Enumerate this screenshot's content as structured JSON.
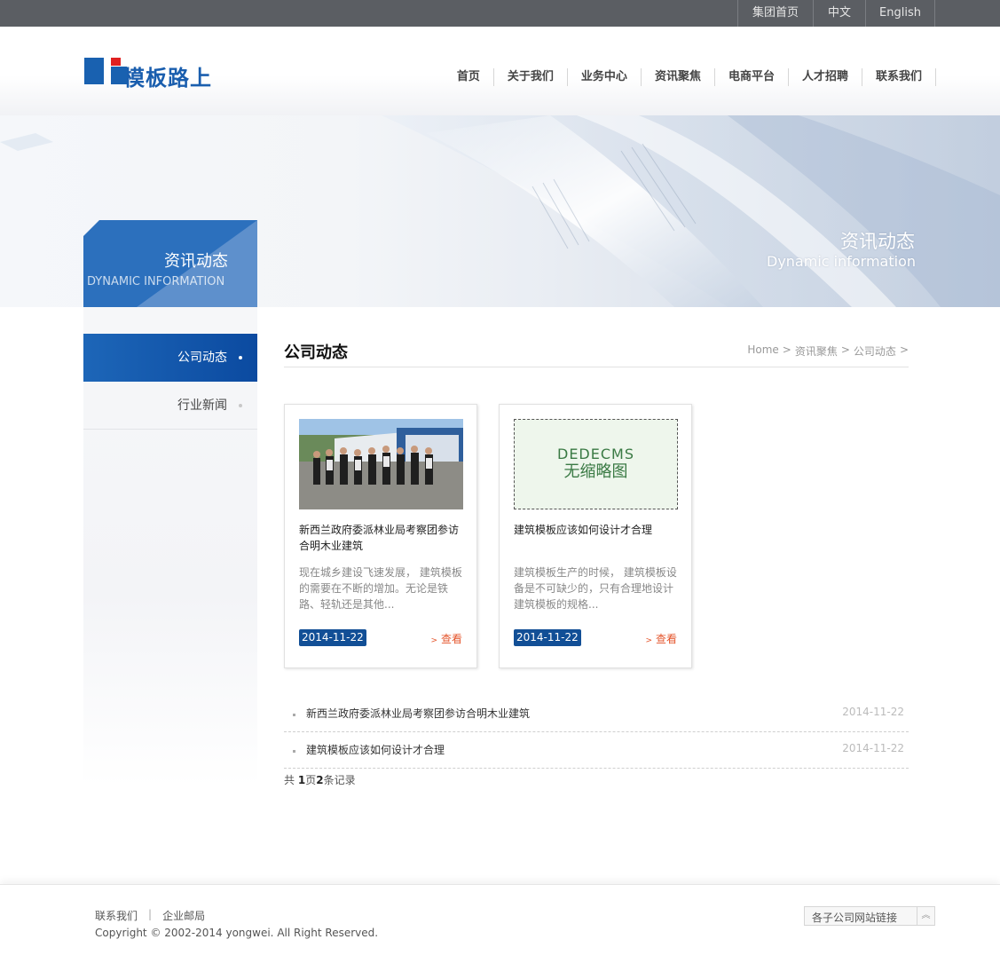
{
  "topbar": {
    "links": [
      "集团首页",
      "中文",
      "English"
    ]
  },
  "logo": {
    "text": "模板路上"
  },
  "nav": [
    "首页",
    "关于我们",
    "业务中心",
    "资讯聚焦",
    "电商平台",
    "人才招聘",
    "联系我们"
  ],
  "banner": {
    "title_cn": "资讯动态",
    "title_en": "Dynamic information"
  },
  "sidebar": {
    "heading_cn": "资讯动态",
    "heading_en": "DYNAMIC INFORMATION",
    "items": [
      {
        "label": "公司动态",
        "active": true
      },
      {
        "label": "行业新闻",
        "active": false
      }
    ]
  },
  "main": {
    "title": "公司动态",
    "breadcrumb": [
      "Home",
      ">",
      "资讯聚焦",
      ">",
      "公司动态",
      ">"
    ],
    "cards": [
      {
        "title": "新西兰政府委派林业局考察团参访合明木业建筑",
        "desc": "现在城乡建设飞速发展， 建筑模板 的需要在不断的增加。无论是铁路、轻轨还是其他...",
        "date": "2014-11-22",
        "more": "查看",
        "more_arrow": ">",
        "image": "group-photo"
      },
      {
        "title": "建筑模板应该如何设计才合理",
        "desc": "建筑模板生产的时候， 建筑模板设备是不可缺少的，只有合理地设计建筑模板的规格...",
        "date": "2014-11-22",
        "more": "查看",
        "more_arrow": ">",
        "image": "no-thumbnail",
        "noimg_line1": "DEDECMS",
        "noimg_line2": "无缩略图"
      }
    ],
    "list": [
      {
        "title": "新西兰政府委派林业局考察团参访合明木业建筑",
        "date": "2014-11-22"
      },
      {
        "title": "建筑模板应该如何设计才合理",
        "date": "2014-11-22"
      }
    ],
    "pager": {
      "prefix": "共 ",
      "pages": "1",
      "mid": "页",
      "records": "2",
      "suffix": "条记录"
    }
  },
  "footer": {
    "links": [
      "联系我们",
      "企业邮局"
    ],
    "separator": "|",
    "copyright": "Copyright © 2002-2014 yongwei. All Right Reserved.",
    "select_label": "各子公司网站链接",
    "select_button": "︽"
  },
  "colors": {
    "brand_blue": "#1961b0",
    "dark_blue": "#124f96",
    "link_orange": "#e4552c",
    "topbar": "#5b5e63"
  }
}
